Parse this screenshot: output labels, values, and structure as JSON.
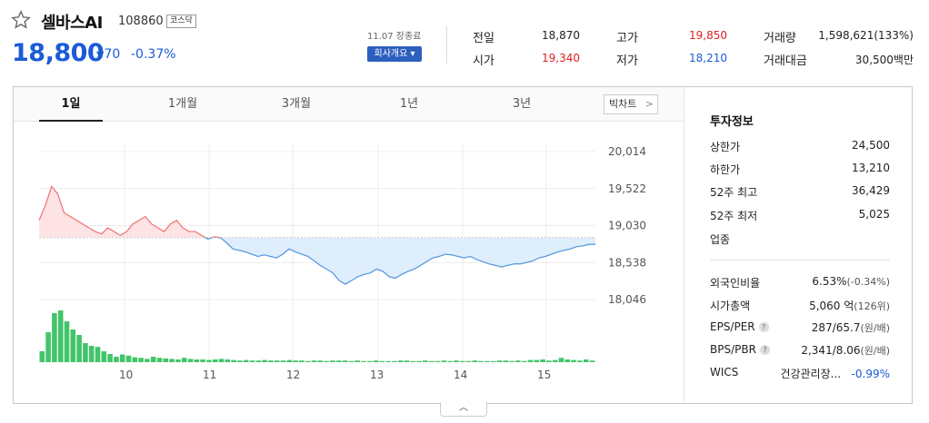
{
  "header": {
    "name": "셀바스AI",
    "code": "108860",
    "market": "코스닥",
    "price": "18,800",
    "change": "70",
    "change_pct": "-0.37%",
    "datetime": "11.07 장종료",
    "company_btn": "회사개요 ▾"
  },
  "stats": {
    "prev_close_label": "전일",
    "prev_close": "18,870",
    "high_label": "고가",
    "high": "19,850",
    "volume_label": "거래량",
    "volume": "1,598,621(133%)",
    "open_label": "시가",
    "open": "19,340",
    "low_label": "저가",
    "low": "18,210",
    "amount_label": "거래대금",
    "amount": "30,500백만"
  },
  "tabs": [
    "1일",
    "1개월",
    "3개월",
    "1년",
    "3년"
  ],
  "big_chart_label": "빅차트",
  "chart_data": {
    "type": "line",
    "y_ticks": [
      "20,014",
      "19,522",
      "19,030",
      "18,538",
      "18,046"
    ],
    "x_ticks": [
      "10",
      "11",
      "12",
      "13",
      "14",
      "15"
    ],
    "prev_close": 18870,
    "ylim": [
      18046,
      20014
    ],
    "price_series": [
      19100,
      19300,
      19550,
      19450,
      19200,
      19150,
      19100,
      19050,
      19000,
      18950,
      18920,
      19000,
      18950,
      18900,
      18950,
      19050,
      19100,
      19150,
      19050,
      19000,
      18950,
      19050,
      19100,
      19000,
      18950,
      18950,
      18900,
      18850,
      18880,
      18870,
      18800,
      18720,
      18700,
      18680,
      18650,
      18620,
      18640,
      18620,
      18600,
      18650,
      18720,
      18680,
      18650,
      18620,
      18560,
      18500,
      18450,
      18400,
      18300,
      18250,
      18300,
      18350,
      18380,
      18400,
      18450,
      18420,
      18350,
      18330,
      18380,
      18420,
      18450,
      18500,
      18550,
      18600,
      18620,
      18650,
      18640,
      18620,
      18600,
      18620,
      18580,
      18550,
      18520,
      18500,
      18480,
      18500,
      18520,
      18520,
      18540,
      18560,
      18600,
      18620,
      18650,
      18680,
      18700,
      18720,
      18750,
      18760,
      18780,
      18780
    ],
    "volume_series": [
      20,
      55,
      90,
      95,
      75,
      60,
      50,
      35,
      30,
      28,
      20,
      15,
      10,
      14,
      12,
      9,
      8,
      6,
      10,
      8,
      7,
      6,
      5,
      8,
      6,
      5,
      5,
      4,
      5,
      6,
      5,
      4,
      3,
      4,
      3,
      3,
      4,
      3,
      3,
      3,
      4,
      3,
      3,
      2,
      3,
      3,
      2,
      3,
      3,
      3,
      2,
      3,
      2,
      2,
      3,
      2,
      2,
      2,
      3,
      3,
      2,
      2,
      3,
      2,
      2,
      3,
      2,
      3,
      2,
      2,
      3,
      2,
      2,
      2,
      3,
      3,
      2,
      3,
      2,
      4,
      4,
      5,
      3,
      4,
      8,
      5,
      4,
      3,
      5,
      3
    ]
  },
  "info": {
    "title": "투자정보",
    "upper_label": "상한가",
    "upper": "24,500",
    "lower_label": "하한가",
    "lower": "13,210",
    "w52_high_label": "52주 최고",
    "w52_high": "36,429",
    "w52_low_label": "52주 최저",
    "w52_low": "5,025",
    "sector_label": "업종",
    "foreign_label": "외국인비율",
    "foreign": "6.53%",
    "foreign_chg": "(-0.34%)",
    "mcap_label": "시가총액",
    "mcap": "5,060 억",
    "mcap_sub": "(126위)",
    "eps_label": "EPS/PER",
    "eps": "287/65.7",
    "eps_sub": "(원/배)",
    "bps_label": "BPS/PBR",
    "bps": "2,341/8.06",
    "bps_sub": "(원/배)",
    "wics_label": "WICS",
    "wics": "건강관리장...",
    "wics_chg": "-0.99%"
  },
  "colors": {
    "up": "#e02020",
    "down": "#1a5bd6",
    "volume": "#43c46a"
  }
}
